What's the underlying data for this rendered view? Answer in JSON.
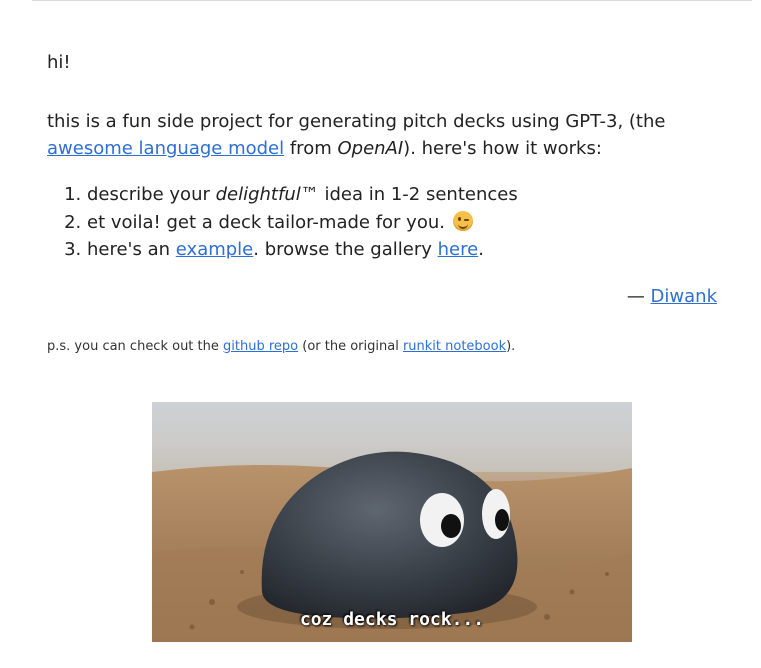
{
  "greeting": "hi!",
  "intro": {
    "part1": "this is a fun side project for generating pitch decks using GPT-3, (the ",
    "link_text": "awesome language model",
    "part2": " from ",
    "company": "OpenAI",
    "part3": "). here's how it works:"
  },
  "steps": {
    "step1_before": "describe your ",
    "step1_emphasis": "delightful™",
    "step1_after": " idea in 1-2 sentences",
    "step2_text": "et voila! get a deck tailor-made for you.",
    "step2_emoji": "winking-face",
    "step3_before": "here's an ",
    "step3_link": "example",
    "step3_middle": ". browse the gallery ",
    "step3_link2": "here",
    "step3_after": "."
  },
  "signature": {
    "dash": "— ",
    "author": "Diwank"
  },
  "ps": {
    "before": "p.s. you can check out the ",
    "repo_link": "github repo",
    "middle": " (or the original ",
    "notebook_link": "runkit notebook",
    "after": ")."
  },
  "hero": {
    "caption": "coz decks rock..."
  },
  "colors": {
    "link": "#2d6fd2",
    "text": "#222222"
  }
}
